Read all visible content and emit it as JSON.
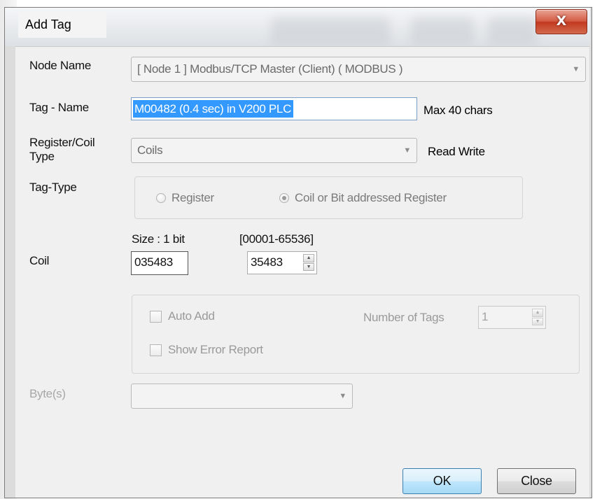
{
  "window": {
    "title": "Add Tag",
    "close_glyph": "X"
  },
  "form": {
    "node_name": {
      "label": "Node Name",
      "value": "[ Node 1 ] Modbus/TCP Master (Client) ( MODBUS )"
    },
    "tag_name": {
      "label": "Tag - Name",
      "value": "M00482 (0.4 sec) in V200 PLC",
      "hint": "Max 40 chars"
    },
    "register_type": {
      "label_line1": "Register/Coil",
      "label_line2": "Type",
      "value": "Coils",
      "access": "Read Write"
    },
    "tag_type": {
      "label": "Tag-Type",
      "options": [
        "Register",
        "Coil or Bit addressed Register"
      ],
      "selected": "Coil or Bit addressed Register"
    },
    "coil": {
      "label": "Coil",
      "size_text": "Size : 1 bit",
      "range_text": "[00001-65536]",
      "address_display": "035483",
      "address_value": "35483"
    },
    "auto_add": {
      "auto_add_label": "Auto Add",
      "auto_add_checked": false,
      "show_error_label": "Show Error Report",
      "show_error_checked": false,
      "num_tags_label": "Number of Tags",
      "num_tags_value": "1"
    },
    "bytes": {
      "label": "Byte(s)",
      "value": ""
    }
  },
  "buttons": {
    "ok": "OK",
    "close": "Close"
  },
  "icons": {
    "dropdown": "chevron-down-icon",
    "spinner": "spin-up-down-icon",
    "close": "close-icon"
  }
}
